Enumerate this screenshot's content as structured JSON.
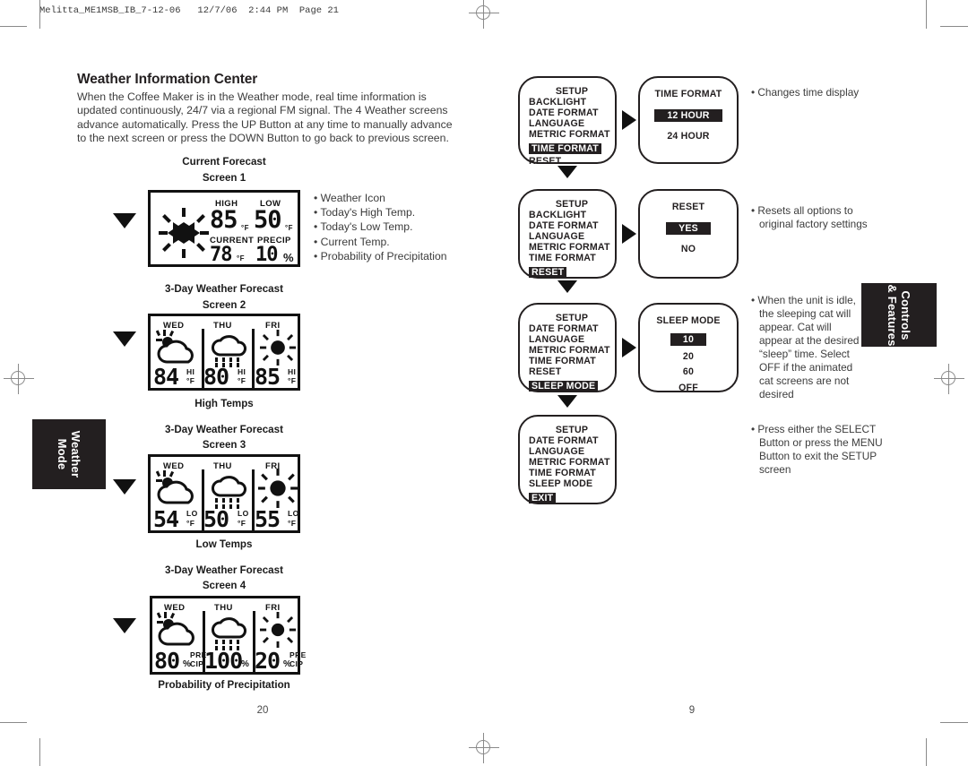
{
  "print_header": "Melitta_ME1MSB_IB_7-12-06   12/7/06  2:44 PM  Page 21",
  "left_page": {
    "title": "Weather Information Center",
    "paragraph": "When the Coffee Maker is in the Weather mode, real time information is updated continuously, 24/7 via a regional FM signal. The 4 Weather screens advance automatically. Press the UP Button at any time to manually advance to the next screen or press the DOWN Button to go back to previous screen.",
    "page_number": "20",
    "tab_label": "Weather Mode",
    "screens": [
      {
        "caption_line1": "Current  Forecast",
        "caption_line2": "Screen 1",
        "caption_below": "",
        "icon": "sun-icon",
        "labels": {
          "high": "HIGH",
          "low": "LOW",
          "current": "CURRENT",
          "precip": "PRECIP"
        },
        "high_value": "85",
        "high_unit": "°F",
        "low_value": "50",
        "low_unit": "°F",
        "current_value": "78",
        "current_unit": "°F",
        "precip_value": "10",
        "precip_unit": "%"
      },
      {
        "caption_line1": "3-Day Weather Forecast",
        "caption_line2": "Screen 2",
        "caption_below": "High Temps",
        "days": [
          {
            "day": "WED",
            "icon": "sun-behind-cloud-icon",
            "value": "84",
            "suffix_top": "HI",
            "suffix_bottom": "°F"
          },
          {
            "day": "THU",
            "icon": "rain-cloud-icon",
            "value": "80",
            "suffix_top": "HI",
            "suffix_bottom": "°F"
          },
          {
            "day": "FRI",
            "icon": "sun-icon",
            "value": "85",
            "suffix_top": "HI",
            "suffix_bottom": "°F"
          }
        ]
      },
      {
        "caption_line1": "3-Day Weather Forecast",
        "caption_line2": "Screen 3",
        "caption_below": "Low Temps",
        "days": [
          {
            "day": "WED",
            "icon": "sun-behind-cloud-icon",
            "value": "54",
            "suffix_top": "LO",
            "suffix_bottom": "°F"
          },
          {
            "day": "THU",
            "icon": "rain-cloud-icon",
            "value": "50",
            "suffix_top": "LO",
            "suffix_bottom": "°F"
          },
          {
            "day": "FRI",
            "icon": "sun-icon",
            "value": "55",
            "suffix_top": "LO",
            "suffix_bottom": "°F"
          }
        ]
      },
      {
        "caption_line1": "3-Day Weather Forecast",
        "caption_line2": "Screen 4",
        "caption_below": "Probability of Precipitation",
        "days": [
          {
            "day": "WED",
            "icon": "sun-behind-cloud-icon",
            "value": "80",
            "suffix_top": "PRE",
            "suffix_bottom": "CIP",
            "pct": "%"
          },
          {
            "day": "THU",
            "icon": "rain-cloud-icon",
            "value": "100",
            "suffix_top": "",
            "suffix_bottom": "",
            "pct": "%"
          },
          {
            "day": "FRI",
            "icon": "sun-icon",
            "value": "20",
            "suffix_top": "PRE",
            "suffix_bottom": "CIP",
            "pct": "%"
          }
        ]
      }
    ],
    "screen1_bullets": [
      "• Weather Icon",
      "• Today's High Temp.",
      "• Today's Low Temp.",
      "• Current Temp.",
      "• Probability of Precipitation"
    ]
  },
  "right_page": {
    "page_number": "9",
    "tab_label": "Controls & Features",
    "menu_rows": [
      {
        "left_menu": {
          "title": "SETUP",
          "items": [
            "BACKLIGHT",
            "DATE FORMAT",
            "LANGUAGE",
            "METRIC FORMAT",
            "TIME FORMAT",
            "RESET"
          ],
          "highlighted": "TIME FORMAT"
        },
        "right_menu": {
          "title": "TIME FORMAT",
          "items": [
            "12 HOUR",
            "24 HOUR"
          ],
          "highlighted": "12 HOUR"
        },
        "note": "• Changes time display"
      },
      {
        "left_menu": {
          "title": "SETUP",
          "items": [
            "BACKLIGHT",
            "DATE FORMAT",
            "LANGUAGE",
            "METRIC FORMAT",
            "TIME FORMAT",
            "RESET"
          ],
          "highlighted": "RESET"
        },
        "right_menu": {
          "title": "RESET",
          "items": [
            "YES",
            "NO"
          ],
          "highlighted": "YES"
        },
        "note": "• Resets all options to original factory settings"
      },
      {
        "left_menu": {
          "title": "SETUP",
          "items": [
            "DATE FORMAT",
            "LANGUAGE",
            "METRIC FORMAT",
            "TIME FORMAT",
            "RESET",
            "SLEEP MODE"
          ],
          "highlighted": "SLEEP MODE"
        },
        "right_menu": {
          "title": "SLEEP MODE",
          "items": [
            "10",
            "20",
            "60",
            "OFF"
          ],
          "highlighted": "10"
        },
        "note": "• When the unit is idle, the sleeping cat will appear. Cat will appear at the desired “sleep” time. Select OFF if the animated cat screens are not desired"
      },
      {
        "left_menu": {
          "title": "SETUP",
          "items": [
            "DATE FORMAT",
            "LANGUAGE",
            "METRIC FORMAT",
            "TIME FORMAT",
            "SLEEP MODE",
            "EXIT"
          ],
          "highlighted": "EXIT"
        },
        "right_menu": null,
        "note": "• Press either the SELECT Button or press the MENU Button to exit the SETUP screen"
      }
    ]
  }
}
